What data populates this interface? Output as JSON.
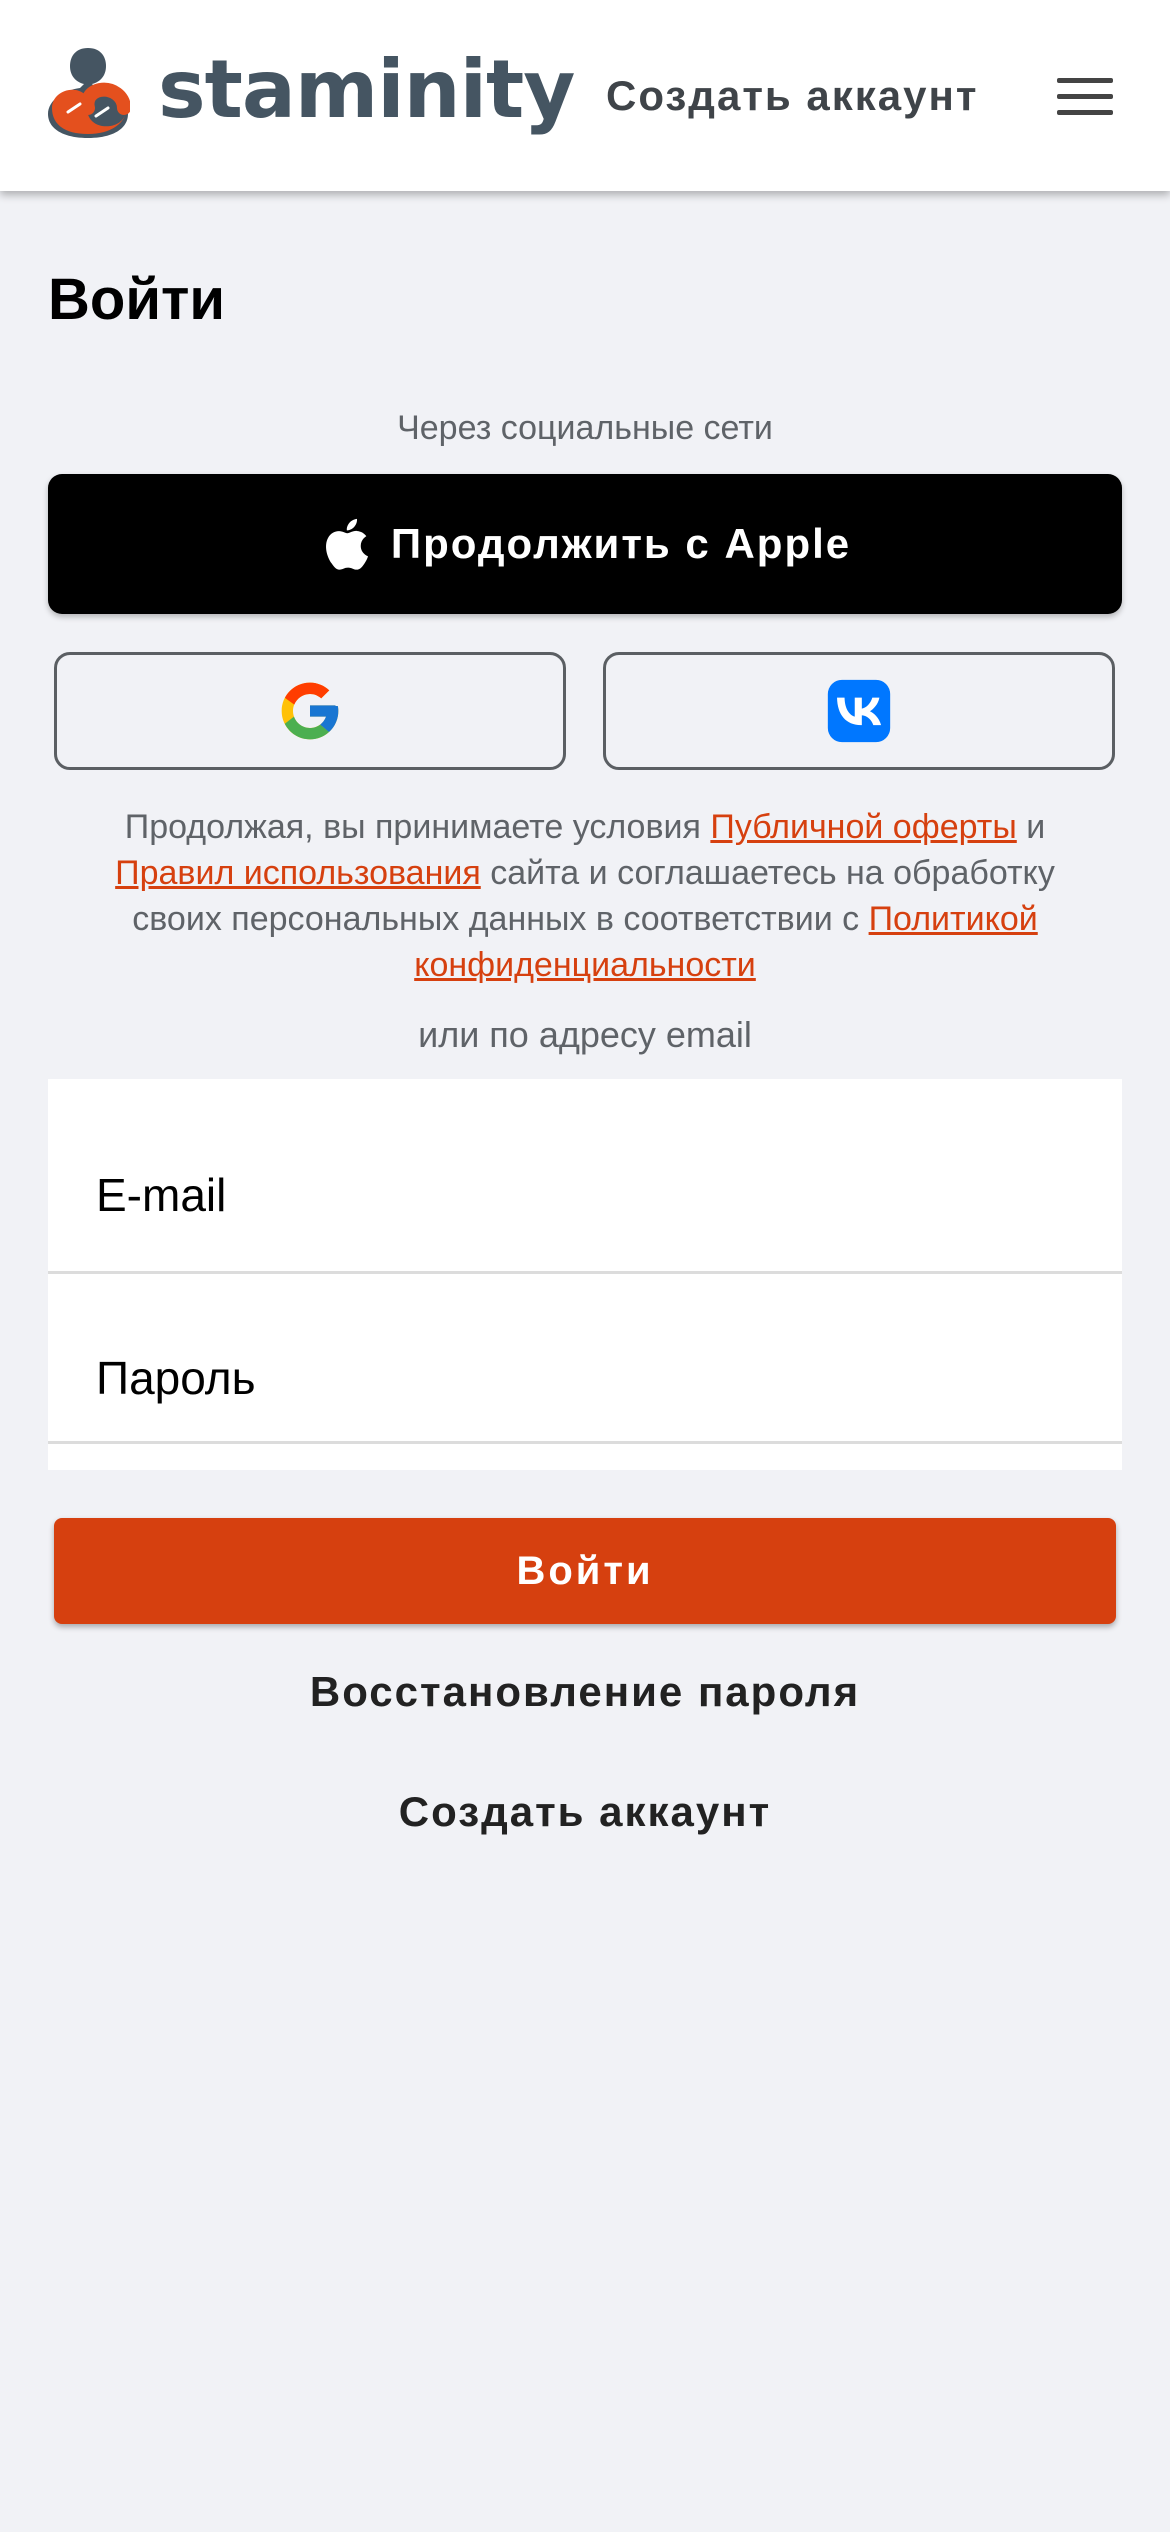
{
  "header": {
    "brand": "staminity",
    "create_account": "Создать аккаунт",
    "menu_icon": "hamburger-menu-icon"
  },
  "page": {
    "title": "Войти"
  },
  "social": {
    "caption": "Через социальные сети",
    "apple_label": "Продолжить с Apple",
    "apple_icon": "apple-icon",
    "google_icon": "google-icon",
    "vk_icon": "vk-icon"
  },
  "terms": {
    "part1": "Продолжая, вы принимаете условия ",
    "offer_link": "Публичной оферты",
    "part2": " и ",
    "rules_link": "Правил использования",
    "part3": " сайта и соглашаетесь на обработку своих персональных данных в соответствии с ",
    "privacy_link": "Политикой конфиденциальности"
  },
  "email_section": {
    "caption": "или по адресу email",
    "email_placeholder": "E-mail",
    "password_placeholder": "Пароль"
  },
  "actions": {
    "login": "Войти",
    "recover_password": "Восстановление пароля",
    "create_account": "Создать аккаунт"
  },
  "colors": {
    "accent": "#d6400f",
    "brand_text": "#455562",
    "background": "#f1f2f6"
  }
}
